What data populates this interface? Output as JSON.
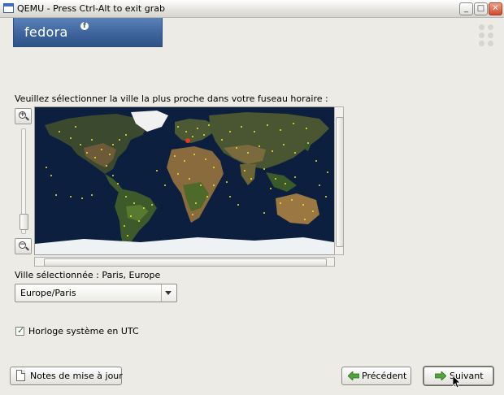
{
  "window": {
    "title": "QEMU - Press Ctrl-Alt to exit grab",
    "minimize_glyph": "_",
    "maximize_glyph": "□",
    "close_glyph": "✕"
  },
  "header": {
    "logo_text": "fedora",
    "logo_mark": "f"
  },
  "timezone": {
    "prompt": "Veuillez sélectionner la ville la plus proche dans votre fuseau horaire :",
    "selected_city_label": "Ville sélectionnée : Paris, Europe",
    "select": {
      "value": "Europe/Paris"
    },
    "utc_checkbox": {
      "label": "Horloge système en UTC",
      "checked": true
    }
  },
  "map": {
    "zoom_in_sign": "+",
    "zoom_out_sign": "−",
    "highlight_color": "#e33b1d",
    "city_dot_color": "#f2e52a",
    "ocean_color": "#0d1f3e"
  },
  "footer": {
    "release_notes_button": "Notes de mise à jour",
    "back_button": "Précédent",
    "next_button": "Suivant"
  },
  "icons": {
    "app": "window-icon",
    "release_notes": "document-icon",
    "back": "left-arrow-icon",
    "next": "right-arrow-icon"
  }
}
